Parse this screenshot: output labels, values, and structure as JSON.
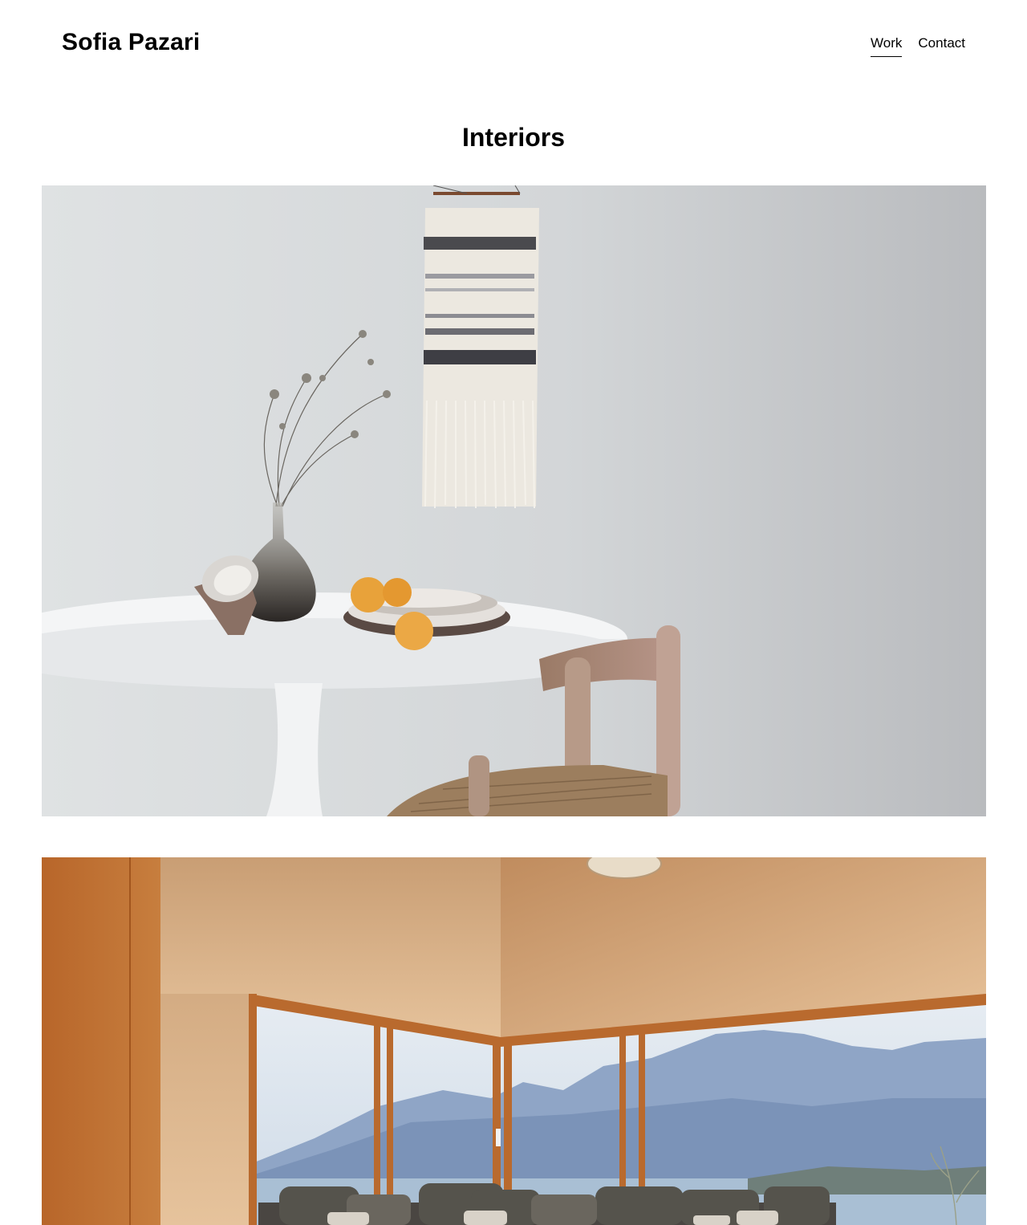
{
  "header": {
    "site_title": "Sofia Pazari",
    "nav": [
      {
        "label": "Work",
        "active": true
      },
      {
        "label": "Contact",
        "active": false
      }
    ]
  },
  "main": {
    "page_title": "Interiors",
    "images": [
      {
        "name": "gallery-image-dining-table"
      },
      {
        "name": "gallery-image-living-room-mountain-view"
      }
    ]
  },
  "colors": {
    "background": "#ffffff",
    "text": "#000000"
  }
}
